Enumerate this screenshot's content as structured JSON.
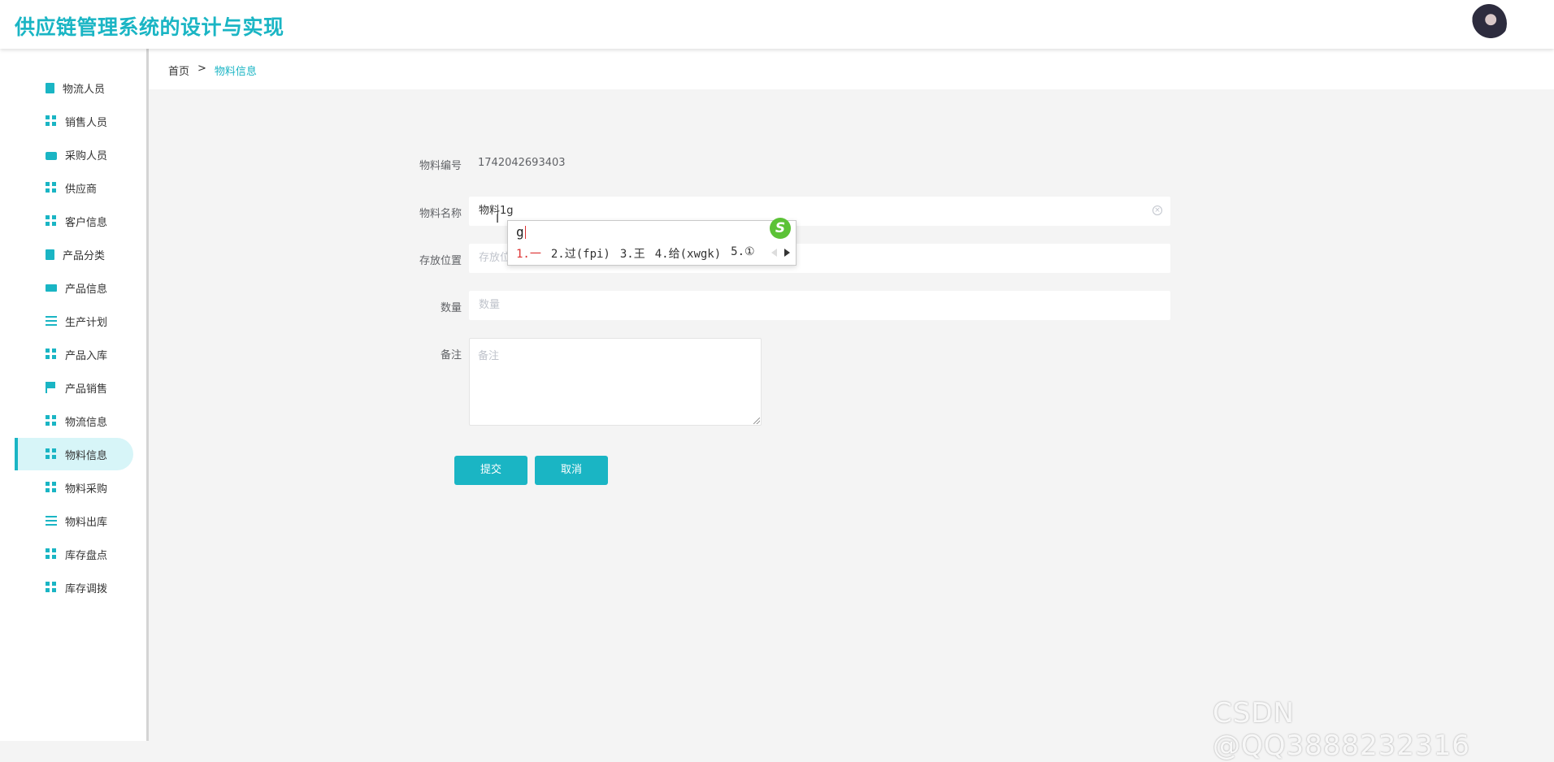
{
  "header": {
    "title": "供应链管理系统的设计与实现"
  },
  "sidebar": {
    "items": [
      {
        "label": "物流人员",
        "icon": "clipboard-icon"
      },
      {
        "label": "销售人员",
        "icon": "grid-icon"
      },
      {
        "label": "采购人员",
        "icon": "briefcase-icon"
      },
      {
        "label": "供应商",
        "icon": "grid-icon"
      },
      {
        "label": "客户信息",
        "icon": "grid-icon"
      },
      {
        "label": "产品分类",
        "icon": "clipboard-icon"
      },
      {
        "label": "产品信息",
        "icon": "monitor-icon"
      },
      {
        "label": "生产计划",
        "icon": "list-icon"
      },
      {
        "label": "产品入库",
        "icon": "grid-icon"
      },
      {
        "label": "产品销售",
        "icon": "flag-icon"
      },
      {
        "label": "物流信息",
        "icon": "grid-icon"
      },
      {
        "label": "物料信息",
        "icon": "grid-icon",
        "active": true
      },
      {
        "label": "物料采购",
        "icon": "grid-icon"
      },
      {
        "label": "物料出库",
        "icon": "list-icon"
      },
      {
        "label": "库存盘点",
        "icon": "grid-icon"
      },
      {
        "label": "库存调拨",
        "icon": "grid-icon"
      }
    ]
  },
  "breadcrumb": {
    "home": "首页",
    "separator": ">",
    "current": "物料信息"
  },
  "form": {
    "code_label": "物料编号",
    "code_value": "1742042693403",
    "name_label": "物料名称",
    "name_value": "物料1g",
    "location_label": "存放位置",
    "location_placeholder": "存放位置",
    "quantity_label": "数量",
    "quantity_placeholder": "数量",
    "remark_label": "备注",
    "remark_placeholder": "备注",
    "submit_label": "提交",
    "cancel_label": "取消"
  },
  "ime": {
    "input": "g",
    "candidates": [
      "1.一",
      "2.过(fpi)",
      "3.王",
      "4.给(xwgk)",
      "5.①"
    ],
    "logo": "S"
  },
  "watermark": "CSDN @QQ3888232316",
  "colors": {
    "accent": "#1ab5c4",
    "background": "#f4f4f4"
  }
}
